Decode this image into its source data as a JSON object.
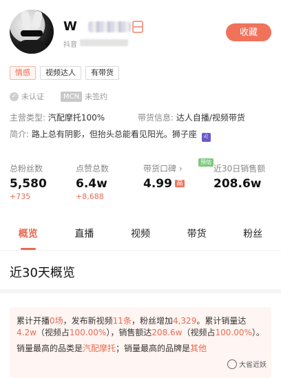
{
  "profile": {
    "name_prefix": "W",
    "platform_label": "抖音",
    "collect_label": "收藏"
  },
  "tags": [
    "情感",
    "视频达人",
    "有带货"
  ],
  "cert": {
    "uncertified": "未认证",
    "mcn_badge": "MCN",
    "unsigned": "未签约"
  },
  "info": {
    "main_category_label": "主营类型:",
    "main_category_value": "汽配摩托100%",
    "sales_info_label": "带货信息:",
    "sales_info_value": "达人自播/视频带货",
    "intro_label": "简介:",
    "intro_value": "路上总有阴影，但抬头总能看见阳光。狮子座",
    "zodiac_glyph": "♌"
  },
  "stats": [
    {
      "label": "总粉丝数",
      "value": "5,580",
      "delta": "+735"
    },
    {
      "label": "点赞总数",
      "value": "6.4w",
      "delta": "+8,688"
    },
    {
      "label": "带货口碑 ›",
      "value": "4.99",
      "badge": "高"
    },
    {
      "label": "近30日销售额",
      "value": "208.6w",
      "tag": "预估"
    }
  ],
  "tabs": [
    "概览",
    "直播",
    "视频",
    "带货",
    "粉丝"
  ],
  "section_title": "近30天概览",
  "summary": {
    "p1_a": "累计开播",
    "p1_b": "0场",
    "p1_c": "，发布新视频",
    "p1_d": "11条",
    "p1_e": "，粉丝增加",
    "p1_f": "4,329",
    "p1_g": "。累计销量达",
    "p1_h": "4.2w",
    "p1_i": "（视频占",
    "p1_j": "100.00%",
    "p1_k": "），销售额达",
    "p1_l": "208.6w",
    "p1_m": "（视频占",
    "p1_n": "100.00%",
    "p1_o": "）。",
    "p2_a": "销量最高的品类是",
    "p2_b": "汽配摩托",
    "p2_c": "；销量最高的品牌是",
    "p2_d": "其他"
  },
  "watermark": "大省近妖",
  "colors": {
    "accent": "#f0725a",
    "accent_text": "#e86a52",
    "estimate": "#7cc97c"
  }
}
